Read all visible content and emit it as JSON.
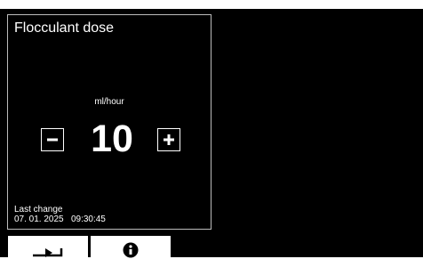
{
  "panel": {
    "title": "Flocculant dose",
    "unit": "ml/hour",
    "value": "10",
    "last_change_label": "Last change",
    "last_change_date": "07. 01. 2025   09:30:45"
  },
  "icons": {
    "minus": "minus-icon",
    "plus": "plus-icon",
    "back": "back-arrow-icon",
    "info": "info-icon"
  },
  "colors": {
    "background": "#000000",
    "foreground": "#ffffff",
    "panel_border": "#bcbcbc"
  }
}
